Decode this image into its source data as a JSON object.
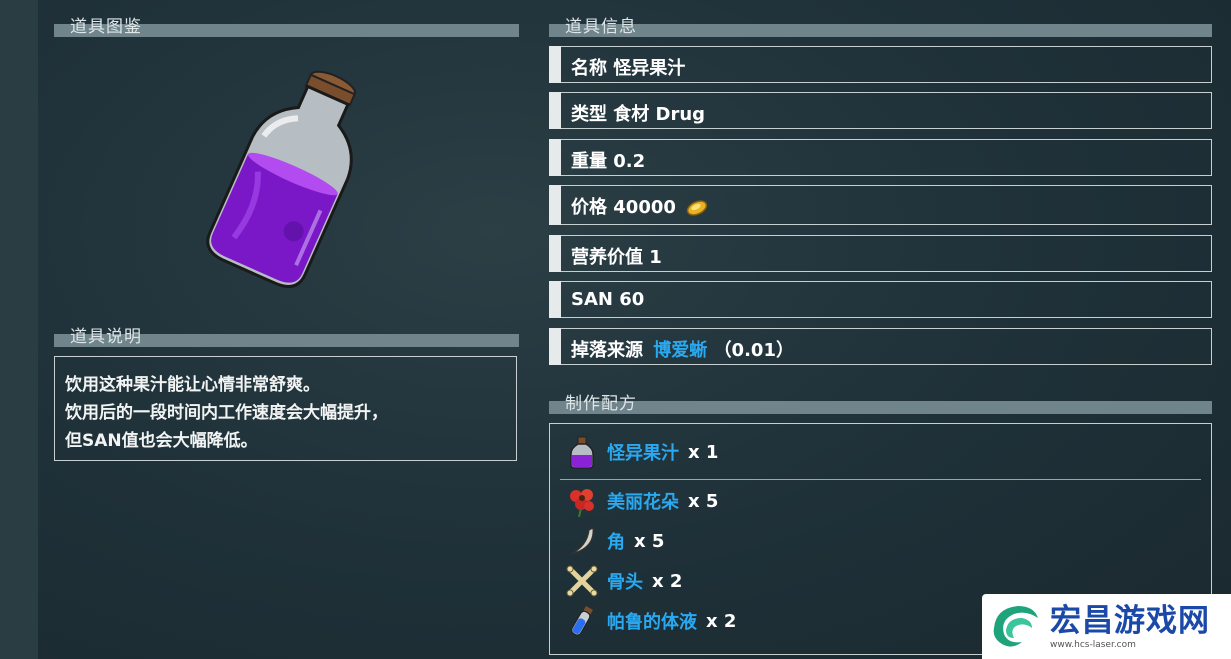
{
  "sections": {
    "gallery_title": "道具图鉴",
    "desc_title": "道具说明",
    "info_title": "道具信息",
    "recipe_title": "制作配方"
  },
  "description": [
    "饮用这种果汁能让心情非常舒爽。",
    "饮用后的一段时间内工作速度会大幅提升，",
    "但SAN值也会大幅降低。"
  ],
  "info": {
    "name": "名称 怪异果汁",
    "type": "类型 食材 Drug",
    "weight": "重量 0.2",
    "price": "价格 40000",
    "nutrition": "营养价值 1",
    "san": "SAN 60",
    "drop_label": "掉落来源",
    "drop_source": "博爱蜥",
    "drop_rate": "（0.01）"
  },
  "recipe": {
    "output": {
      "name": "怪异果汁",
      "qty": "x 1",
      "icon": "purple-bottle-icon"
    },
    "ingredients": [
      {
        "name": "美丽花朵",
        "qty": "x 5",
        "icon": "flower-icon"
      },
      {
        "name": "角",
        "qty": "x 5",
        "icon": "horn-icon"
      },
      {
        "name": "骨头",
        "qty": "x 2",
        "icon": "bone-icon"
      },
      {
        "name": "帕鲁的体液",
        "qty": "x 2",
        "icon": "blue-vial-icon"
      }
    ]
  },
  "watermark": {
    "title": "宏昌游戏网",
    "url": "www.hcs-laser.com"
  },
  "colors": {
    "link": "#2aa8f0",
    "bar": "#6f848b",
    "juice": "#8a22d6"
  }
}
